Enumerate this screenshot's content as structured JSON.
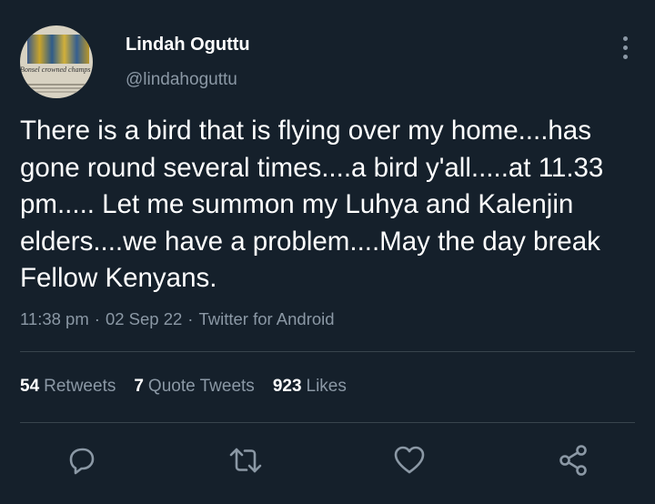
{
  "author": {
    "name": "Lindah Oguttu",
    "handle": "@lindahoguttu",
    "avatar_caption": "Bonsel crowned champs / Fortune Sacco promoted"
  },
  "tweet": {
    "text": "There is a bird that is flying over my home....has gone round several times....a bird y'all.....at 11.33 pm..... Let me summon my Luhya and Kalenjin elders....we have a problem....May the day break Fellow Kenyans.",
    "time": "11:38 pm",
    "date": "02 Sep 22",
    "source": "Twitter for Android",
    "separator": "·"
  },
  "stats": {
    "retweets_count": "54",
    "retweets_label": "Retweets",
    "quotes_count": "7",
    "quotes_label": "Quote Tweets",
    "likes_count": "923",
    "likes_label": "Likes"
  },
  "actions": [
    "reply-icon",
    "retweet-icon",
    "like-icon",
    "share-icon"
  ],
  "colors": {
    "background": "#15202b",
    "primary_text": "#ffffff",
    "secondary_text": "#8b98a5",
    "divider": "#38444d"
  }
}
